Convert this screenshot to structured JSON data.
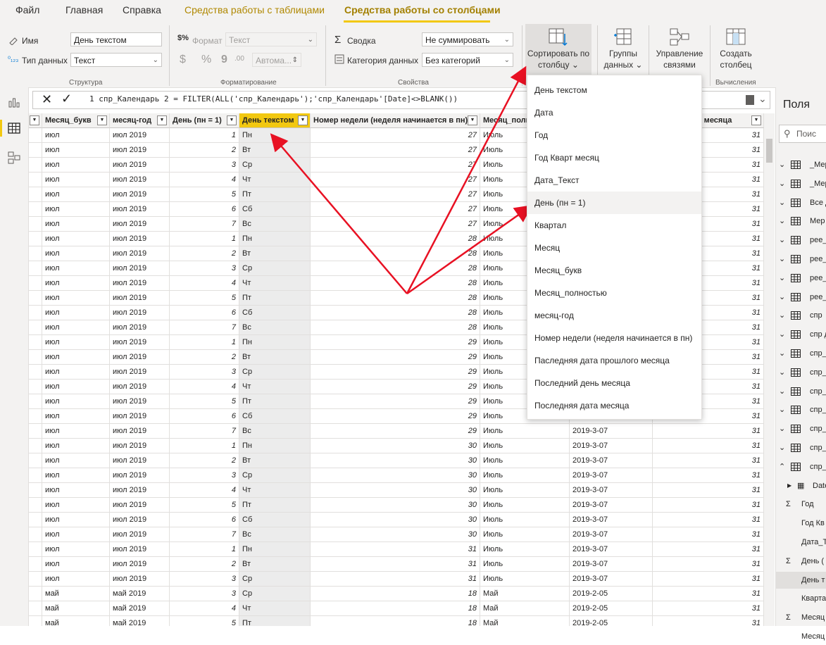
{
  "menu": {
    "items": [
      "Файл",
      "Главная",
      "Справка"
    ],
    "ctx_table": "Средства работы с таблицами",
    "ctx_column": "Средства работы со столбцами"
  },
  "ribbon": {
    "name_label": "Имя",
    "name_value": "День текстом",
    "datatype_label": "Тип данных",
    "datatype_value": "Текст",
    "structure_caption": "Структура",
    "format_label": "Формат",
    "format_value": "Текст",
    "auto_value": "Автома...",
    "currency": "$",
    "percent": "%",
    "comma": "9",
    "decimals": ".00",
    "formatting_caption": "Форматирование",
    "summary_label": "Сводка",
    "summary_value": "Не суммировать",
    "category_label": "Категория данных",
    "category_value": "Без категорий",
    "properties_caption": "Свойства",
    "sort_line1": "Сортировать по",
    "sort_line2": "столбцу",
    "groups_line1": "Группы",
    "groups_line2": "данных",
    "relations_line1": "Управление",
    "relations_line2": "связями",
    "newcol_line1": "Создать",
    "newcol_line2": "столбец",
    "calc_caption": "Вычисления"
  },
  "formula": {
    "text": "1  спр_Календарь 2 = FILTER(ALL('спр_Календарь');'спр_Календарь'[Date]<>BLANK())"
  },
  "table": {
    "headers": [
      "Месяц_букв",
      "месяц-год",
      "День (пн = 1)",
      "День текстом",
      "Номер недели (неделя начинается в пн)",
      "Месяц_полн",
      "",
      "ата месяца"
    ],
    "rows": [
      [
        "июл",
        "июл 2019",
        "1",
        "Пн",
        "27",
        "Июль",
        "",
        "31"
      ],
      [
        "июл",
        "июл 2019",
        "2",
        "Вт",
        "27",
        "Июль",
        "",
        "31"
      ],
      [
        "июл",
        "июл 2019",
        "3",
        "Ср",
        "27",
        "Июль",
        "",
        "31"
      ],
      [
        "июл",
        "июл 2019",
        "4",
        "Чт",
        "27",
        "Июль",
        "",
        "31"
      ],
      [
        "июл",
        "июл 2019",
        "5",
        "Пт",
        "27",
        "Июль",
        "",
        "31"
      ],
      [
        "июл",
        "июл 2019",
        "6",
        "Сб",
        "27",
        "Июль",
        "",
        "31"
      ],
      [
        "июл",
        "июл 2019",
        "7",
        "Вс",
        "27",
        "Июль",
        "",
        "31"
      ],
      [
        "июл",
        "июл 2019",
        "1",
        "Пн",
        "28",
        "Июль",
        "",
        "31"
      ],
      [
        "июл",
        "июл 2019",
        "2",
        "Вт",
        "28",
        "Июль",
        "",
        "31"
      ],
      [
        "июл",
        "июл 2019",
        "3",
        "Ср",
        "28",
        "Июль",
        "",
        "31"
      ],
      [
        "июл",
        "июл 2019",
        "4",
        "Чт",
        "28",
        "Июль",
        "",
        "31"
      ],
      [
        "июл",
        "июл 2019",
        "5",
        "Пт",
        "28",
        "Июль",
        "",
        "31"
      ],
      [
        "июл",
        "июл 2019",
        "6",
        "Сб",
        "28",
        "Июль",
        "",
        "31"
      ],
      [
        "июл",
        "июл 2019",
        "7",
        "Вс",
        "28",
        "Июль",
        "",
        "31"
      ],
      [
        "июл",
        "июл 2019",
        "1",
        "Пн",
        "29",
        "Июль",
        "",
        "31"
      ],
      [
        "июл",
        "июл 2019",
        "2",
        "Вт",
        "29",
        "Июль",
        "",
        "31"
      ],
      [
        "июл",
        "июл 2019",
        "3",
        "Ср",
        "29",
        "Июль",
        "",
        "31"
      ],
      [
        "июл",
        "июл 2019",
        "4",
        "Чт",
        "29",
        "Июль",
        "",
        "31"
      ],
      [
        "июл",
        "июл 2019",
        "5",
        "Пт",
        "29",
        "Июль",
        "",
        "31"
      ],
      [
        "июл",
        "июл 2019",
        "6",
        "Сб",
        "29",
        "Июль",
        "",
        "31"
      ],
      [
        "июл",
        "июл 2019",
        "7",
        "Вс",
        "29",
        "Июль",
        "2019-3-07",
        "31"
      ],
      [
        "июл",
        "июл 2019",
        "1",
        "Пн",
        "30",
        "Июль",
        "2019-3-07",
        "31"
      ],
      [
        "июл",
        "июл 2019",
        "2",
        "Вт",
        "30",
        "Июль",
        "2019-3-07",
        "31"
      ],
      [
        "июл",
        "июл 2019",
        "3",
        "Ср",
        "30",
        "Июль",
        "2019-3-07",
        "31"
      ],
      [
        "июл",
        "июл 2019",
        "4",
        "Чт",
        "30",
        "Июль",
        "2019-3-07",
        "31"
      ],
      [
        "июл",
        "июл 2019",
        "5",
        "Пт",
        "30",
        "Июль",
        "2019-3-07",
        "31"
      ],
      [
        "июл",
        "июл 2019",
        "6",
        "Сб",
        "30",
        "Июль",
        "2019-3-07",
        "31"
      ],
      [
        "июл",
        "июл 2019",
        "7",
        "Вс",
        "30",
        "Июль",
        "2019-3-07",
        "31"
      ],
      [
        "июл",
        "июл 2019",
        "1",
        "Пн",
        "31",
        "Июль",
        "2019-3-07",
        "31"
      ],
      [
        "июл",
        "июл 2019",
        "2",
        "Вт",
        "31",
        "Июль",
        "2019-3-07",
        "31"
      ],
      [
        "июл",
        "июл 2019",
        "3",
        "Ср",
        "31",
        "Июль",
        "2019-3-07",
        "31"
      ],
      [
        "май",
        "май 2019",
        "3",
        "Ср",
        "18",
        "Май",
        "2019-2-05",
        "31"
      ],
      [
        "май",
        "май 2019",
        "4",
        "Чт",
        "18",
        "Май",
        "2019-2-05",
        "31"
      ],
      [
        "май",
        "май 2019",
        "5",
        "Пт",
        "18",
        "Май",
        "2019-2-05",
        "31"
      ]
    ]
  },
  "dropdown": {
    "items": [
      "День текстом",
      "Дата",
      "Год",
      "Год Кварт месяц",
      "Дата_Текст",
      "День (пн = 1)",
      "Квартал",
      "Месяц",
      "Месяц_букв",
      "Месяц_полностью",
      "месяц-год",
      "Номер недели (неделя начинается в пн)",
      "Паследняя дата прошлого месяца",
      "Последний день месяца",
      "Последняя дата месяца"
    ],
    "hover_index": 5
  },
  "fields": {
    "title": "Поля",
    "search_placeholder": "Поис",
    "items": [
      {
        "label": "_Мер",
        "kind": "table"
      },
      {
        "label": "_Мер",
        "kind": "table"
      },
      {
        "label": "Все д",
        "kind": "table"
      },
      {
        "label": "Мер",
        "kind": "table"
      },
      {
        "label": "рее_",
        "kind": "table"
      },
      {
        "label": "рее_",
        "kind": "table"
      },
      {
        "label": "рее_",
        "kind": "table"
      },
      {
        "label": "рее_",
        "kind": "table"
      },
      {
        "label": "спр",
        "kind": "table"
      },
      {
        "label": "спр д",
        "kind": "table"
      },
      {
        "label": "спр_",
        "kind": "table"
      },
      {
        "label": "спр_",
        "kind": "table"
      },
      {
        "label": "спр_",
        "kind": "table"
      },
      {
        "label": "спр_",
        "kind": "table"
      },
      {
        "label": "спр_",
        "kind": "table"
      },
      {
        "label": "спр_",
        "kind": "table"
      },
      {
        "label": "спр_",
        "kind": "table-open"
      },
      {
        "label": "Date",
        "kind": "date"
      },
      {
        "label": "Год",
        "kind": "sigma"
      },
      {
        "label": "Год Кв",
        "kind": "field"
      },
      {
        "label": "Дата_Т",
        "kind": "field"
      },
      {
        "label": "День (",
        "kind": "sigma"
      },
      {
        "label": "День т",
        "kind": "field-sel"
      },
      {
        "label": "Кварта",
        "kind": "field"
      },
      {
        "label": "Месяц",
        "kind": "sigma"
      },
      {
        "label": "Месяц",
        "kind": "field"
      }
    ]
  },
  "colors": {
    "accent": "#f2c811",
    "arrow": "#e81123",
    "ctx_text": "#b08800"
  }
}
